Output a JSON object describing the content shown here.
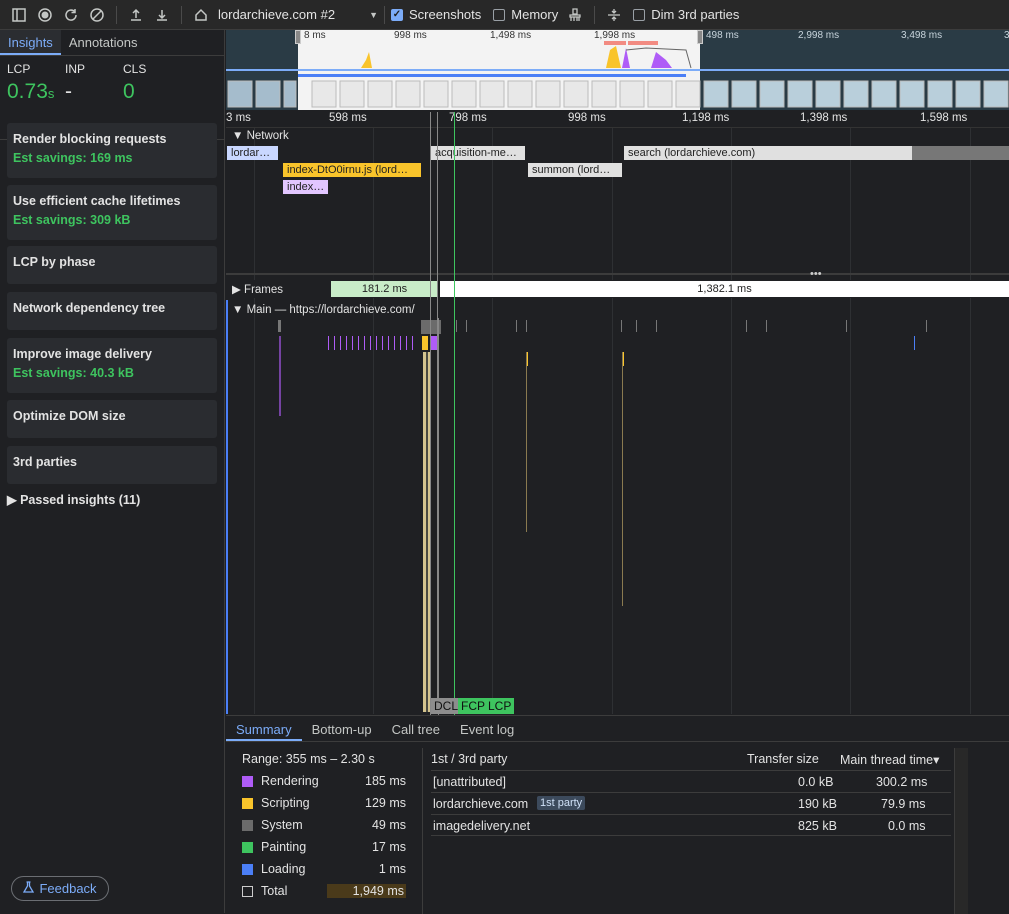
{
  "toolbar": {
    "recording_select": "lordarchieve.com #2",
    "screenshots_label": "Screenshots",
    "memory_label": "Memory",
    "dim3p_label": "Dim 3rd parties"
  },
  "sidebar": {
    "tabs": [
      "Insights",
      "Annotations"
    ],
    "metrics": [
      {
        "label": "LCP",
        "value": "0.73",
        "unit": "s"
      },
      {
        "label": "INP",
        "value": "-",
        "unit": ""
      },
      {
        "label": "CLS",
        "value": "0",
        "unit": ""
      }
    ],
    "insights": [
      {
        "title": "Render blocking requests",
        "savings": "Est savings: 169 ms"
      },
      {
        "title": "Use efficient cache lifetimes",
        "savings": "Est savings: 309 kB"
      },
      {
        "title": "LCP by phase",
        "savings": ""
      },
      {
        "title": "Network dependency tree",
        "savings": ""
      },
      {
        "title": "Improve image delivery",
        "savings": "Est savings: 40.3 kB"
      },
      {
        "title": "Optimize DOM size",
        "savings": ""
      },
      {
        "title": "3rd parties",
        "savings": ""
      }
    ],
    "passed": "Passed insights (11)",
    "feedback": "Feedback"
  },
  "overview": {
    "ticks": [
      "8 ms",
      "998 ms",
      "1,498 ms",
      "1,998 ms",
      "498 ms",
      "2,998 ms",
      "3,498 ms",
      "3"
    ]
  },
  "ruler": {
    "ticks": [
      "3 ms",
      "598 ms",
      "798 ms",
      "998 ms",
      "1,198 ms",
      "1,398 ms",
      "1,598 ms"
    ]
  },
  "network": {
    "label": "Network",
    "requests": [
      "lordar…",
      "index-DtO0irnu.js (lord…",
      "index…",
      "acquisition-me…",
      "summon (lord…",
      "search (lordarchieve.com)"
    ]
  },
  "frames": {
    "label": "Frames",
    "frame1": "181.2 ms",
    "frame2": "1,382.1 ms"
  },
  "main": {
    "label": "Main — https://lordarchieve.com/"
  },
  "markers": [
    "DCL",
    "FCP",
    "LCP"
  ],
  "bottom": {
    "tabs": [
      "Summary",
      "Bottom-up",
      "Call tree",
      "Event log"
    ],
    "range": "Range: 355 ms – 2.30 s",
    "legend": [
      {
        "name": "Rendering",
        "value": "185 ms",
        "color": "#af5cf7"
      },
      {
        "name": "Scripting",
        "value": "129 ms",
        "color": "#f9c42b"
      },
      {
        "name": "System",
        "value": "49 ms",
        "color": "#6b6b6b"
      },
      {
        "name": "Painting",
        "value": "17 ms",
        "color": "#3ec45f"
      },
      {
        "name": "Loading",
        "value": "1 ms",
        "color": "#4b7ff6"
      },
      {
        "name": "Total",
        "value": "1,949 ms",
        "color": "transparent"
      }
    ],
    "table": {
      "headers": [
        "1st / 3rd party",
        "Transfer size",
        "Main thread time"
      ],
      "rows": [
        {
          "party": "[unattributed]",
          "badge": "",
          "size": "0.0 kB",
          "time": "300.2 ms"
        },
        {
          "party": "lordarchieve.com",
          "badge": "1st party",
          "size": "190 kB",
          "time": "79.9 ms"
        },
        {
          "party": "imagedelivery.net",
          "badge": "",
          "size": "825 kB",
          "time": "0.0 ms"
        }
      ]
    }
  }
}
